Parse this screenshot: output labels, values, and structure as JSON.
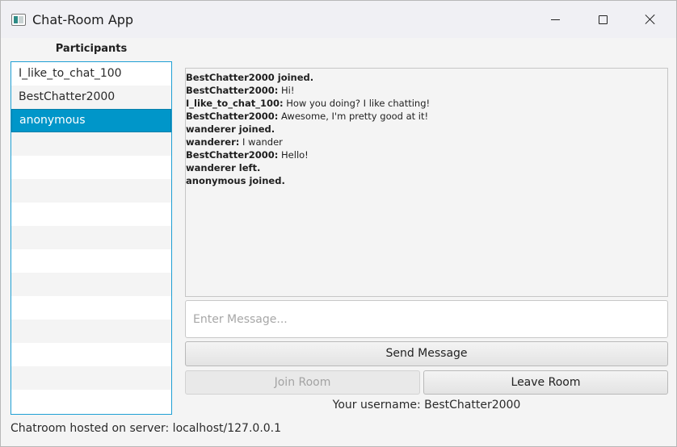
{
  "window": {
    "title": "Chat-Room App"
  },
  "participants": {
    "header": "Participants",
    "items": [
      "I_like_to_chat_100",
      "BestChatter2000",
      "anonymous"
    ],
    "selected": "anonymous"
  },
  "chat": {
    "messages": [
      {
        "sender": "BestChatter2000 joined.",
        "text": ""
      },
      {
        "sender": "BestChatter2000:",
        "text": " Hi!"
      },
      {
        "sender": "I_like_to_chat_100:",
        "text": " How you doing? I like chatting!"
      },
      {
        "sender": "BestChatter2000:",
        "text": " Awesome, I'm pretty good at it!"
      },
      {
        "sender": "wanderer joined.",
        "text": ""
      },
      {
        "sender": "wanderer:",
        "text": " I wander"
      },
      {
        "sender": "BestChatter2000:",
        "text": " Hello!"
      },
      {
        "sender": "wanderer left.",
        "text": ""
      },
      {
        "sender": "anonymous joined.",
        "text": ""
      }
    ]
  },
  "input": {
    "placeholder": "Enter Message...",
    "value": ""
  },
  "buttons": {
    "send": "Send Message",
    "join": "Join Room",
    "leave": "Leave Room"
  },
  "user": {
    "username_label": "Your username: BestChatter2000"
  },
  "status": {
    "text": "Chatroom hosted on server: localhost/127.0.0.1"
  },
  "colors": {
    "selection": "#0096c9",
    "list_border": "#1fa0d4"
  }
}
